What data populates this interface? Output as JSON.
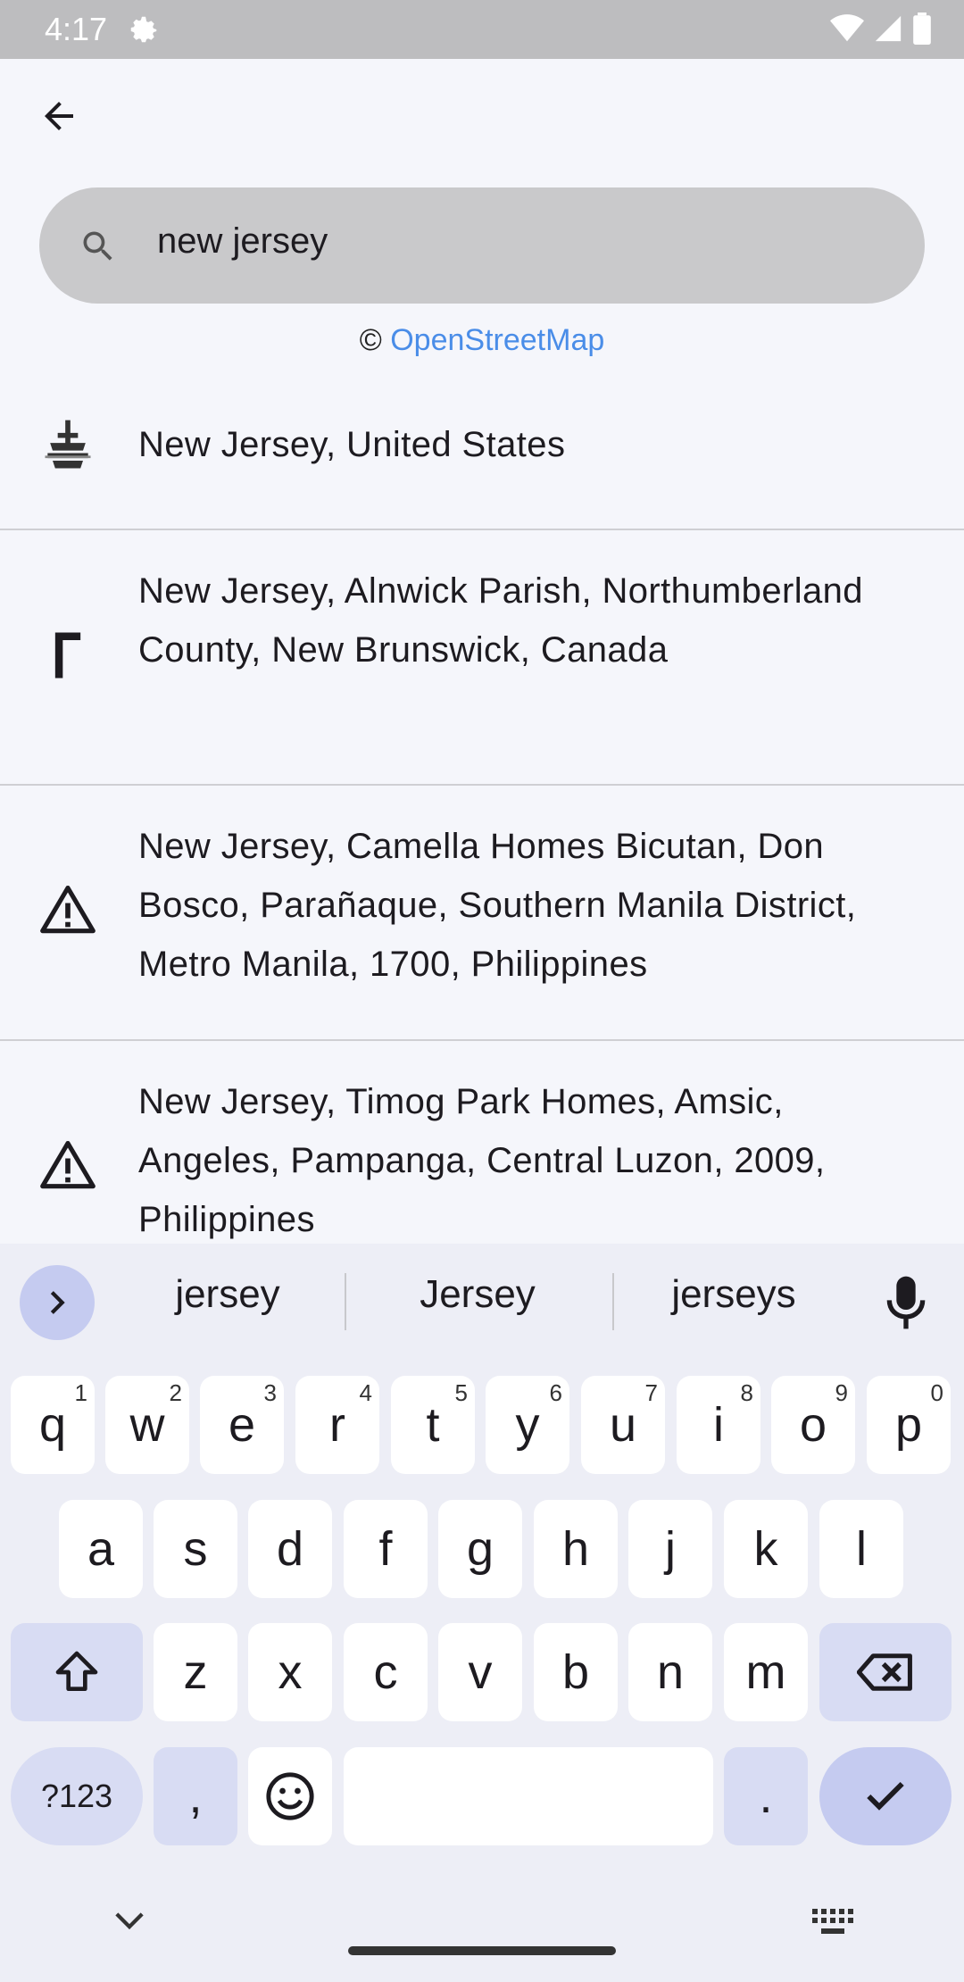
{
  "status_bar": {
    "time": "4:17",
    "icons": [
      "settings-icon",
      "wifi-icon",
      "signal-icon",
      "battery-icon"
    ]
  },
  "app_bar": {
    "back_icon": "arrow-back-icon"
  },
  "search": {
    "value": "new jersey",
    "icon": "search-icon"
  },
  "attribution": {
    "symbol": "©",
    "link_text": "OpenStreetMap",
    "link_color": "#4a8de8"
  },
  "results": [
    {
      "icon": "fountain-icon",
      "text": "New Jersey, United States"
    },
    {
      "icon": "flag-pole-icon",
      "text": "New Jersey, Alnwick Parish, Northumberland County, New Brunswick, Canada"
    },
    {
      "icon": "warning-icon",
      "text": "New Jersey, Camella Homes Bicutan, Don Bosco, Parañaque, Southern Manila District, Metro Manila, 1700, Philippines"
    },
    {
      "icon": "warning-icon",
      "text": "New Jersey, Timog Park Homes, Amsic, Angeles, Pampanga, Central Luzon, 2009, Philippines"
    }
  ],
  "keyboard": {
    "suggestions": [
      "jersey",
      "Jersey",
      "jerseys"
    ],
    "row1": [
      {
        "k": "q",
        "h": "1"
      },
      {
        "k": "w",
        "h": "2"
      },
      {
        "k": "e",
        "h": "3"
      },
      {
        "k": "r",
        "h": "4"
      },
      {
        "k": "t",
        "h": "5"
      },
      {
        "k": "y",
        "h": "6"
      },
      {
        "k": "u",
        "h": "7"
      },
      {
        "k": "i",
        "h": "8"
      },
      {
        "k": "o",
        "h": "9"
      },
      {
        "k": "p",
        "h": "0"
      }
    ],
    "row2": [
      "a",
      "s",
      "d",
      "f",
      "g",
      "h",
      "j",
      "k",
      "l"
    ],
    "row3": [
      "z",
      "x",
      "c",
      "v",
      "b",
      "n",
      "m"
    ],
    "symbols_label": "?123",
    "comma_label": ",",
    "period_label": ".",
    "accent_color": "#c5cbf0"
  }
}
